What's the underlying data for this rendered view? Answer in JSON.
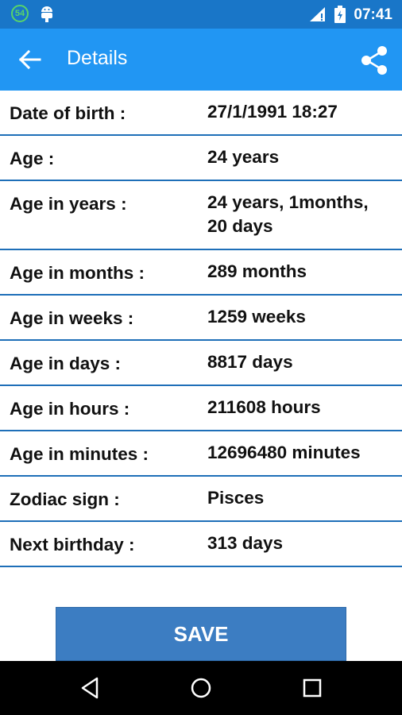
{
  "status_bar": {
    "notification_count": "54",
    "time": "07:41"
  },
  "app_bar": {
    "title": "Details",
    "icons": [
      "back-arrow-icon",
      "share-icon"
    ]
  },
  "details": [
    {
      "label": "Date of birth :",
      "value": "27/1/1991  18:27"
    },
    {
      "label": "Age :",
      "value": "24  years"
    },
    {
      "label": "Age in years :",
      "value": "24 years, 1months,\n20 days"
    },
    {
      "label": "Age in months :",
      "value": "289  months"
    },
    {
      "label": "Age in weeks :",
      "value": "1259  weeks"
    },
    {
      "label": "Age in days :",
      "value": "8817  days"
    },
    {
      "label": "Age in hours :",
      "value": "211608  hours"
    },
    {
      "label": "Age in minutes :",
      "value": "12696480  minutes"
    },
    {
      "label": "Zodiac sign :",
      "value": "Pisces"
    },
    {
      "label": "Next birthday :",
      "value": "313 days"
    }
  ],
  "actions": {
    "save_label": "SAVE"
  },
  "nav_bar": {
    "icons": [
      "back-triangle-icon",
      "home-circle-icon",
      "recents-square-icon"
    ]
  },
  "colors": {
    "status_bar": "#1976c8",
    "app_bar": "#2196f3",
    "divider": "#1e6fb8",
    "save_button": "#3c7dc2"
  }
}
